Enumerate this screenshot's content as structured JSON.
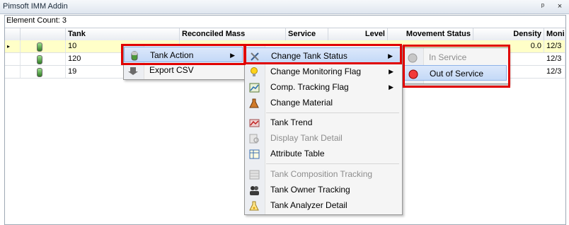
{
  "window": {
    "title": "Pimsoft IMM Addin",
    "pin_glyph": "ᵖ",
    "close_glyph": "×"
  },
  "element_count": "Element Count: 3",
  "table": {
    "columns": [
      "Tank",
      "Reconciled Mass",
      "Service",
      "Level",
      "Movement Status",
      "Density",
      "Moni"
    ],
    "rows": [
      {
        "indicator": "▸",
        "tank": "10",
        "density": "0.0",
        "moni": "12/3",
        "selected": true
      },
      {
        "indicator": "",
        "tank": "120",
        "density": "",
        "moni": "12/3",
        "selected": false
      },
      {
        "indicator": "",
        "tank": "19",
        "density": "",
        "moni": "12/3",
        "selected": false
      }
    ]
  },
  "context_menu": {
    "items": [
      {
        "label": "Tank Action",
        "icon": "tank-icon",
        "submenu_arrow": "▶"
      },
      {
        "label": "Export CSV",
        "icon": "export-icon"
      }
    ]
  },
  "submenu": {
    "items": [
      {
        "label": "Change Tank Status",
        "icon": "tools-icon",
        "arrow": "▶"
      },
      {
        "label": "Change Monitoring Flag",
        "icon": "lightbulb-icon",
        "arrow": "▶"
      },
      {
        "label": "Comp. Tracking Flag",
        "icon": "chart-icon",
        "arrow": "▶"
      },
      {
        "label": "Change Material",
        "icon": "flask-icon"
      },
      {
        "label": "Tank Trend",
        "icon": "trend-icon"
      },
      {
        "label": "Display Tank Detail",
        "icon": "detail-icon",
        "disabled": true
      },
      {
        "label": "Attribute Table",
        "icon": "table-icon"
      },
      {
        "label": "Tank Composition Tracking",
        "icon": "composition-icon",
        "disabled": true
      },
      {
        "label": "Tank Owner Tracking",
        "icon": "people-icon"
      },
      {
        "label": "Tank Analyzer Detail",
        "icon": "beaker-icon"
      }
    ]
  },
  "status_menu": {
    "items": [
      {
        "label": "In Service",
        "icon": "grey-circle-icon",
        "disabled": true
      },
      {
        "label": "Out of Service",
        "icon": "red-circle-icon"
      }
    ]
  },
  "colors": {
    "highlight_border": "#e00000",
    "selected_row": "#ffffc8"
  }
}
